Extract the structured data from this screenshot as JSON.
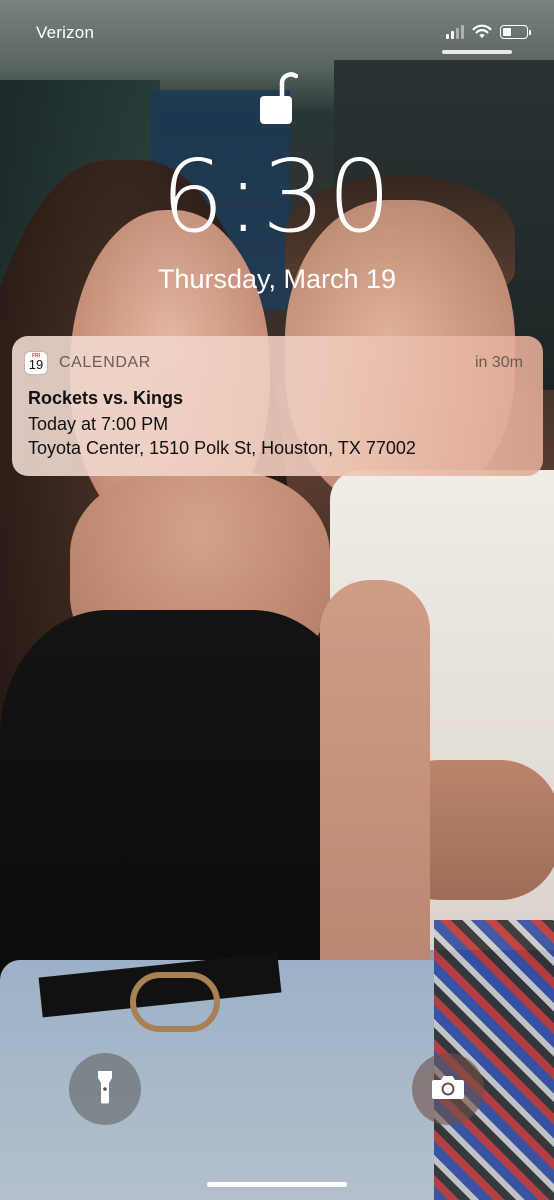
{
  "status_bar": {
    "carrier": "Verizon",
    "signal_bars": 4,
    "signal_active_bars": 2,
    "wifi_icon": "wifi-icon",
    "battery_icon": "battery-icon",
    "battery_level": 0.3
  },
  "lock": {
    "icon": "unlocked-padlock-icon"
  },
  "clock": {
    "time": "6:30",
    "date": "Thursday, March 19"
  },
  "notification": {
    "app_icon_day": "FRI",
    "app_icon_number": "19",
    "app_name": "CALENDAR",
    "time_ago": "in 30m",
    "title": "Rockets vs. Kings",
    "line1": "Today at 7:00 PM",
    "line2": "Toyota Center, 1510 Polk St, Houston, TX 77002"
  },
  "controls": {
    "flashlight_icon": "flashlight-icon",
    "camera_icon": "camera-icon"
  },
  "colors": {
    "notification_bg_start": "#f2ded6",
    "notification_bg_end": "#e2aa96",
    "text_primary": "#111111",
    "text_secondary": "#6b5b55"
  }
}
